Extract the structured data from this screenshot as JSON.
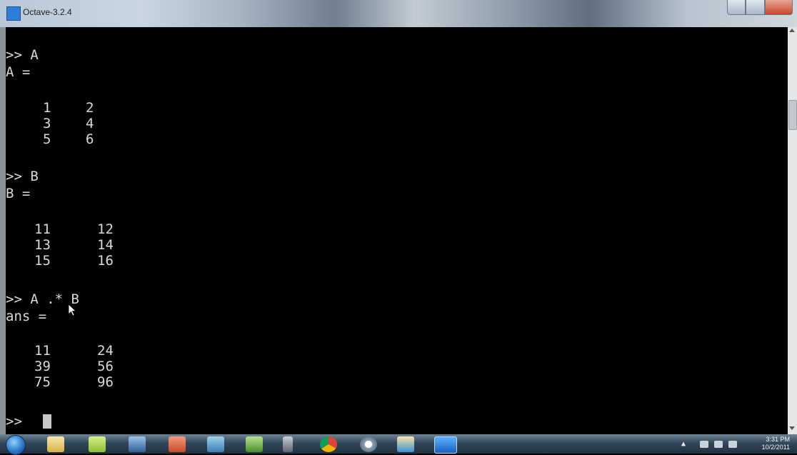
{
  "window": {
    "title": "Octave-3.2.4"
  },
  "console": {
    "cmd_a": ">> A",
    "a_header": "A =",
    "a_rows": [
      [
        "1",
        "2"
      ],
      [
        "3",
        "4"
      ],
      [
        "5",
        "6"
      ]
    ],
    "cmd_b": ">> B",
    "b_header": "B =",
    "b_rows": [
      [
        "11",
        "12"
      ],
      [
        "13",
        "14"
      ],
      [
        "15",
        "16"
      ]
    ],
    "cmd_mul": ">> A .* B",
    "ans_header": "ans =",
    "ans_rows": [
      [
        "11",
        "24"
      ],
      [
        "39",
        "56"
      ],
      [
        "75",
        "96"
      ]
    ],
    "prompt": ">>"
  },
  "taskbar": {
    "icons": [
      "start-orb",
      "windows-explorer",
      "sticky-notes",
      "media-player",
      "powerpoint",
      "network",
      "remote-desktop",
      "calculator",
      "chrome",
      "search",
      "paint",
      "octave"
    ],
    "clock_time": "3:31 PM",
    "clock_date": "10/2/2011"
  },
  "colors": {
    "console_bg": "#000000",
    "console_text": "#d9d9d9",
    "accent": "#2f7fd8"
  }
}
